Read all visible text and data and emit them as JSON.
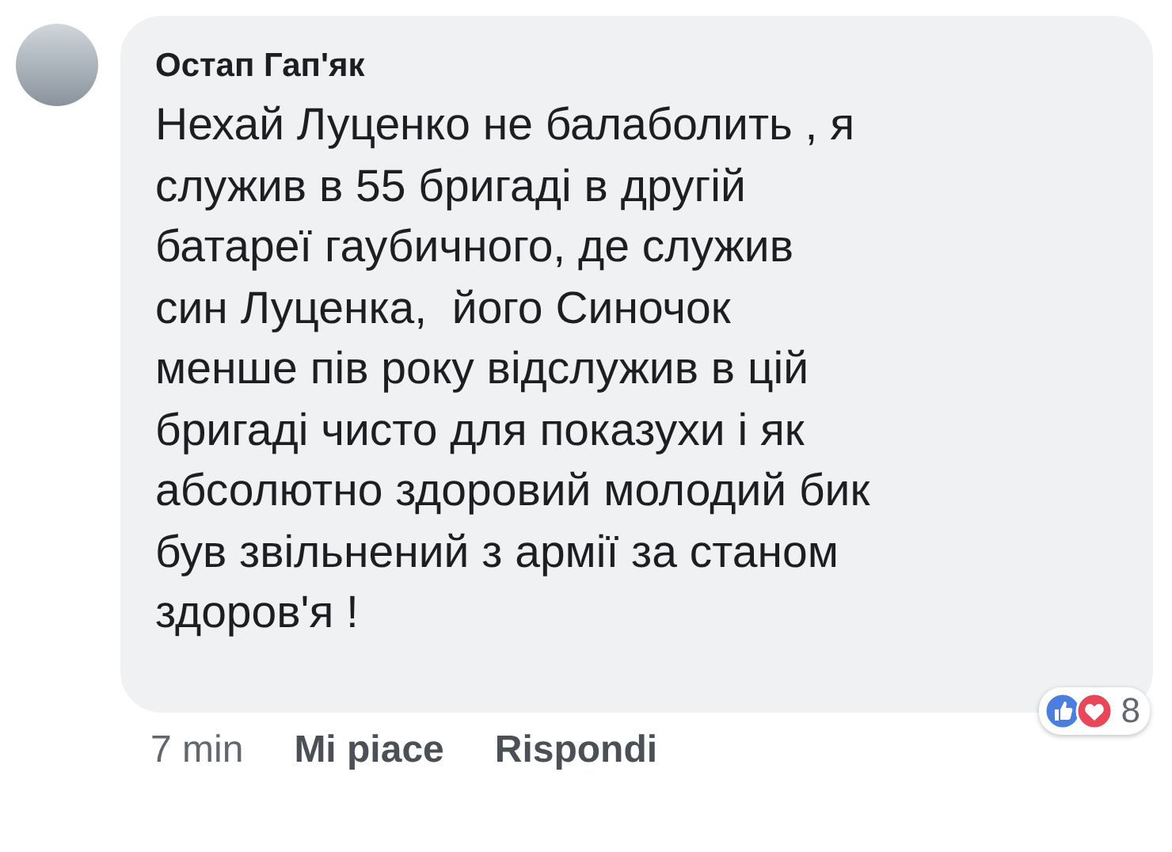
{
  "comment": {
    "author": "Остап Гап'як",
    "text": "Нехай Луценко не балаболить , я\nслужив в 55 бригаді в другій\nбатареї гаубичного, де служив\nсин Луценка,  його Синочок\nменше пів року відслужив в цій\nбригаді чисто для показухи і як\nабсолютно здоровий молодий бик\nбув звільнений з армії за станом\nздоров'я !"
  },
  "footer": {
    "time": "7 min",
    "actions": [
      "Mi piace",
      "Rispondi"
    ],
    "reaction_count": "8"
  }
}
